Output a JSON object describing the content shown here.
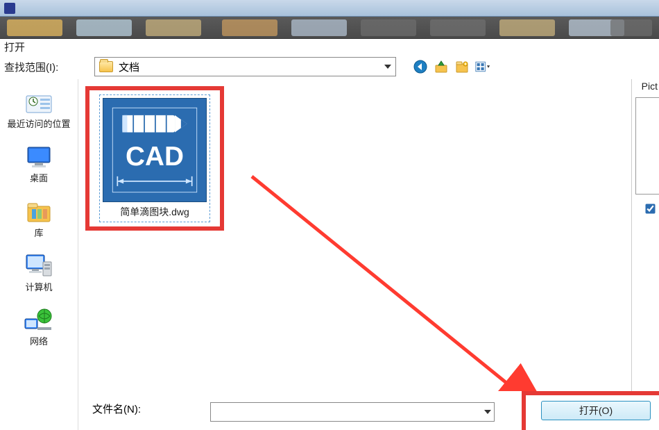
{
  "window": {
    "title": "打开"
  },
  "lookin": {
    "label": "查找范围(I):",
    "selected": "文档"
  },
  "places": {
    "recent": "最近访问的位置",
    "desktop": "桌面",
    "libraries": "库",
    "computer": "计算机",
    "network": "网络"
  },
  "file": {
    "name": "简单滴图块.dwg",
    "thumb_text": "CAD"
  },
  "bottom": {
    "filename_label": "文件名(N):",
    "filename_value": "",
    "open_button": "打开(O)"
  },
  "right": {
    "preview_label": "Pict",
    "checkbox_checked": true
  },
  "icons": {
    "back": "back-icon",
    "up": "up-icon",
    "newfolder": "new-folder-icon",
    "view": "view-icon"
  }
}
